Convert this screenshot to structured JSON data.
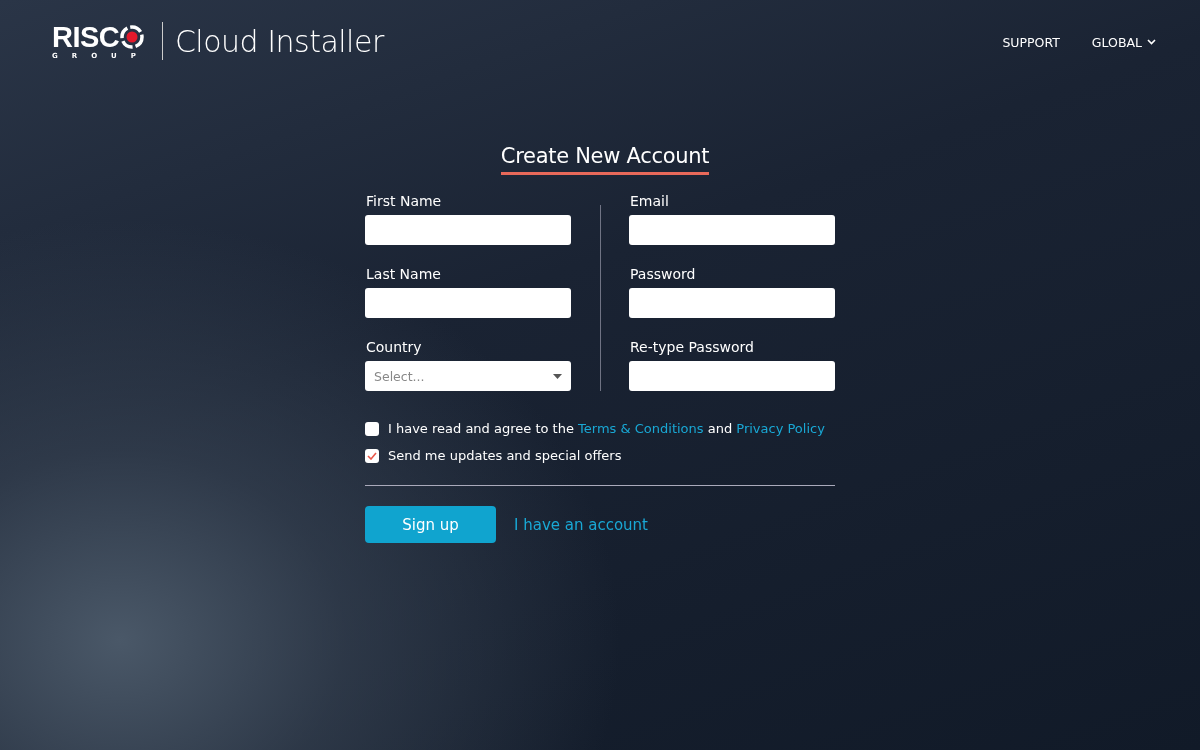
{
  "brand": {
    "wordmark": "RISC",
    "tagline": "GROUP",
    "product": "Cloud Installer"
  },
  "nav": [
    {
      "label": "SUPPORT",
      "dropdown": false
    },
    {
      "label": "GLOBAL",
      "dropdown": true
    }
  ],
  "title": "Create New Account",
  "left_fields": [
    {
      "label": "First Name",
      "kind": "text"
    },
    {
      "label": "Last Name",
      "kind": "text"
    },
    {
      "label": "Country",
      "kind": "select",
      "placeholder": "Select..."
    }
  ],
  "right_fields": [
    {
      "label": "Email"
    },
    {
      "label": "Password"
    },
    {
      "label": "Re-type Password"
    }
  ],
  "checkboxes": [
    {
      "checked": false,
      "parts": [
        {
          "text": "I have read and agree to the ",
          "link": false
        },
        {
          "text": "Terms & Conditions",
          "link": true
        },
        {
          "text": " and ",
          "link": false
        },
        {
          "text": "Privacy Policy",
          "link": true
        }
      ]
    },
    {
      "checked": true,
      "parts": [
        {
          "text": "Send me updates and special offers",
          "link": false
        }
      ]
    }
  ],
  "primary_button": "Sign up",
  "secondary_link": "I have an account"
}
